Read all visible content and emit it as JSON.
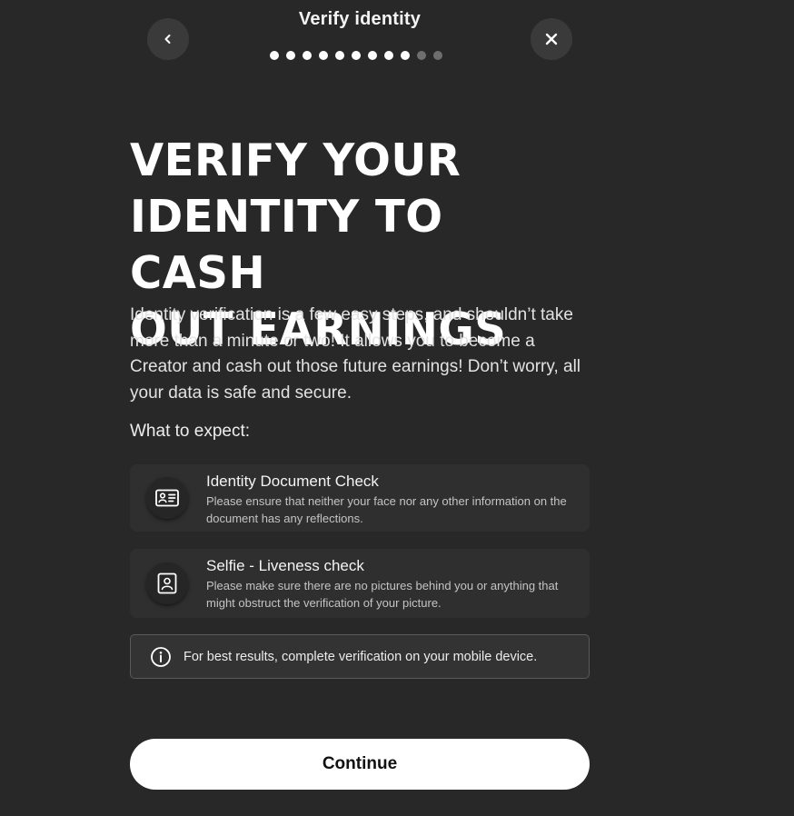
{
  "header": {
    "title": "Verify identity",
    "back_icon": "chevron-left-icon",
    "close_icon": "close-icon"
  },
  "progress": {
    "total_steps": 11,
    "current_step": 9
  },
  "main": {
    "headline_lines": [
      "VERIFY YOUR",
      "IDENTITY TO CASH",
      "OUT EARNINGS"
    ],
    "intro": "Identity verification is a few easy steps, and shouldn’t take more than a minute or two! It allows you to become a Creator and cash out those future earnings! Don’t worry, all your data is safe and secure.",
    "expect_label": "What to expect:",
    "steps": [
      {
        "icon": "id-card-icon",
        "title": "Identity Document Check",
        "description": "Please ensure that neither your face nor any other information on the document has any reflections."
      },
      {
        "icon": "selfie-icon",
        "title": "Selfie - Liveness check",
        "description": "Please make sure there are no pictures behind you or anything that might obstruct the verification of your picture."
      }
    ],
    "info": {
      "icon": "info-icon",
      "text": "For best results, complete verification on your mobile device."
    },
    "continue_label": "Continue"
  },
  "colors": {
    "background": "#282828",
    "card": "#2f2f2f",
    "button": "#ffffff",
    "button_text": "#111111",
    "dot_active": "#ffffff",
    "dot_inactive": "#6e6e6e"
  }
}
